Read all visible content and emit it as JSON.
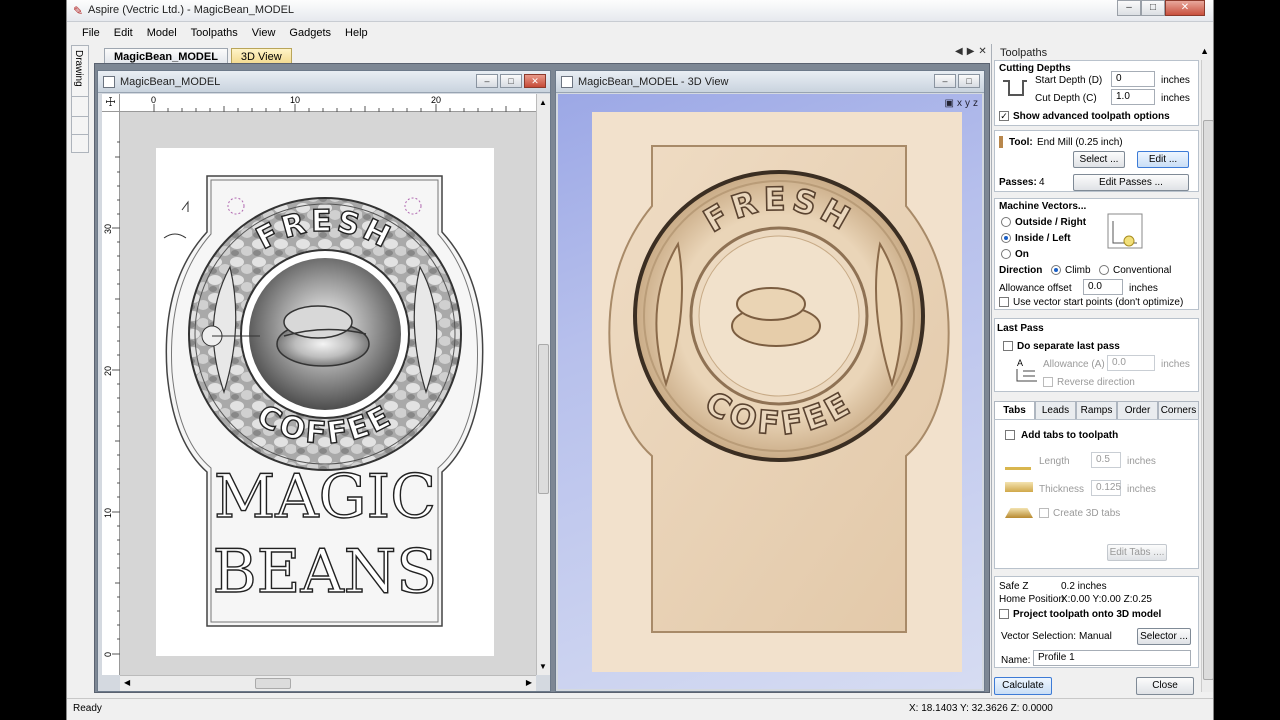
{
  "window": {
    "title": "Aspire (Vectric Ltd.) - MagicBean_MODEL"
  },
  "menu": [
    "File",
    "Edit",
    "Model",
    "Toolpaths",
    "View",
    "Gadgets",
    "Help"
  ],
  "side_tab": {
    "label": "Drawing"
  },
  "doc_tabs": [
    {
      "label": "MagicBean_MODEL"
    },
    {
      "label": "3D View"
    }
  ],
  "view2d": {
    "title": "MagicBean_MODEL",
    "ruler_h": [
      "0",
      "10",
      "20"
    ],
    "ruler_v": [
      "30",
      "20",
      "10",
      "0"
    ]
  },
  "view3d": {
    "title": "MagicBean_MODEL - 3D View",
    "icons": [
      "x",
      "y",
      "z"
    ]
  },
  "artwork": {
    "top_text": "FRESH",
    "bottom_text": "COFFEE",
    "line1": "MAGIC",
    "line2": "BEANS"
  },
  "panel": {
    "title": "Toolpaths",
    "cutting_depths": {
      "heading": "Cutting Depths",
      "start_label": "Start Depth (D)",
      "start_value": "0",
      "start_unit": "inches",
      "cut_label": "Cut Depth (C)",
      "cut_value": "1.0",
      "cut_unit": "inches",
      "advanced_label": "Show advanced toolpath options"
    },
    "tool": {
      "label": "Tool:",
      "name": "End Mill (0.25 inch)",
      "select": "Select ...",
      "edit": "Edit ...",
      "passes_label": "Passes:",
      "passes_value": "4",
      "edit_passes": "Edit Passes ..."
    },
    "machine_vectors": {
      "heading": "Machine Vectors...",
      "outside": "Outside / Right",
      "inside": "Inside / Left",
      "on": "On",
      "direction": "Direction",
      "climb": "Climb",
      "conventional": "Conventional",
      "allowance_label": "Allowance offset",
      "allowance_value": "0.0",
      "allowance_unit": "inches",
      "start_points": "Use vector start points (don't optimize)"
    },
    "last_pass": {
      "heading": "Last Pass",
      "separate": "Do separate last pass",
      "allowance_label": "Allowance (A)",
      "allowance_value": "0.0",
      "allowance_unit": "inches",
      "reverse": "Reverse direction",
      "glyph": "A"
    },
    "tabs_row": [
      "Tabs",
      "Leads",
      "Ramps",
      "Order",
      "Corners"
    ],
    "tabs": {
      "add": "Add tabs to toolpath",
      "length_label": "Length",
      "length_value": "0.5",
      "length_unit": "inches",
      "thickness_label": "Thickness",
      "thickness_value": "0.125",
      "thickness_unit": "inches",
      "create3d": "Create 3D tabs",
      "edit": "Edit Tabs ...."
    },
    "settings": {
      "safez_label": "Safe Z",
      "safez_value": "0.2 inches",
      "home_label": "Home Position",
      "home_value": "X:0.00 Y:0.00 Z:0.25",
      "project": "Project toolpath onto 3D model",
      "vector_sel_label": "Vector Selection:",
      "vector_sel_value": "Manual",
      "selector": "Selector ...",
      "name_label": "Name:",
      "name_value": "Profile 1"
    },
    "calculate": "Calculate",
    "close": "Close"
  },
  "status": {
    "left": "Ready",
    "coords": "X: 18.1403 Y: 32.3626 Z: 0.0000"
  }
}
